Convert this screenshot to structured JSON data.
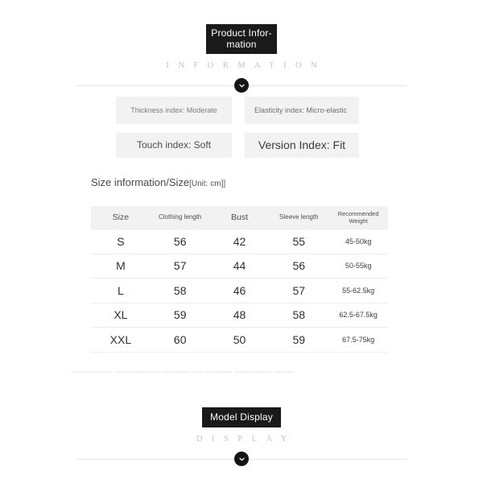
{
  "top_section": {
    "title": "Product Infor-mation",
    "subtitle": "INFORMATION",
    "badge_icon": "chevron-down-icon"
  },
  "attributes": [
    {
      "key": "thickness",
      "label": "Thickness index: Moderate"
    },
    {
      "key": "elasticity",
      "label": "Elasticity index: Micro-elastic"
    },
    {
      "key": "touch",
      "label": "Touch index: Soft"
    },
    {
      "key": "version",
      "label": "Version Index: Fit"
    }
  ],
  "size_section": {
    "heading_main": "Size information/Size",
    "heading_unit": "[Unit: cm]]",
    "disclaimer": "* Manual measurement error 1 ~ 3cm please understand that there may be differences in different colors/sizes/batches. The product is subject to the actual product."
  },
  "size_table": {
    "columns": [
      {
        "label": "Size",
        "style": "big"
      },
      {
        "label": "Clothing length",
        "style": "small"
      },
      {
        "label": "Bust",
        "style": "big"
      },
      {
        "label": "Sleeve length",
        "style": "small"
      },
      {
        "label": "Recommended Weight",
        "style": "tiny"
      }
    ],
    "rows": [
      {
        "size": "S",
        "clothing_length": "56",
        "bust": "42",
        "sleeve_length": "55",
        "recommended_weight": "45-50kg"
      },
      {
        "size": "M",
        "clothing_length": "57",
        "bust": "44",
        "sleeve_length": "56",
        "recommended_weight": "50-55kg"
      },
      {
        "size": "L",
        "clothing_length": "58",
        "bust": "46",
        "sleeve_length": "57",
        "recommended_weight": "55-62.5kg"
      },
      {
        "size": "XL",
        "clothing_length": "59",
        "bust": "48",
        "sleeve_length": "58",
        "recommended_weight": "62.5-67.5kg"
      },
      {
        "size": "XXL",
        "clothing_length": "60",
        "bust": "50",
        "sleeve_length": "59",
        "recommended_weight": "67.5-75kg"
      }
    ]
  },
  "bottom_section": {
    "title": "Model Display",
    "subtitle": "DISPLAY",
    "badge_icon": "chevron-down-icon"
  },
  "colors": {
    "banner_background": "#1a1a1a",
    "banner_text": "#ffffff",
    "subtitle_text": "#c3c3c3",
    "attr_box_background": "#f2f2f3",
    "table_header_background": "#f2f2f2",
    "divider": "#e4e4e4",
    "page_background": "#ffffff"
  }
}
